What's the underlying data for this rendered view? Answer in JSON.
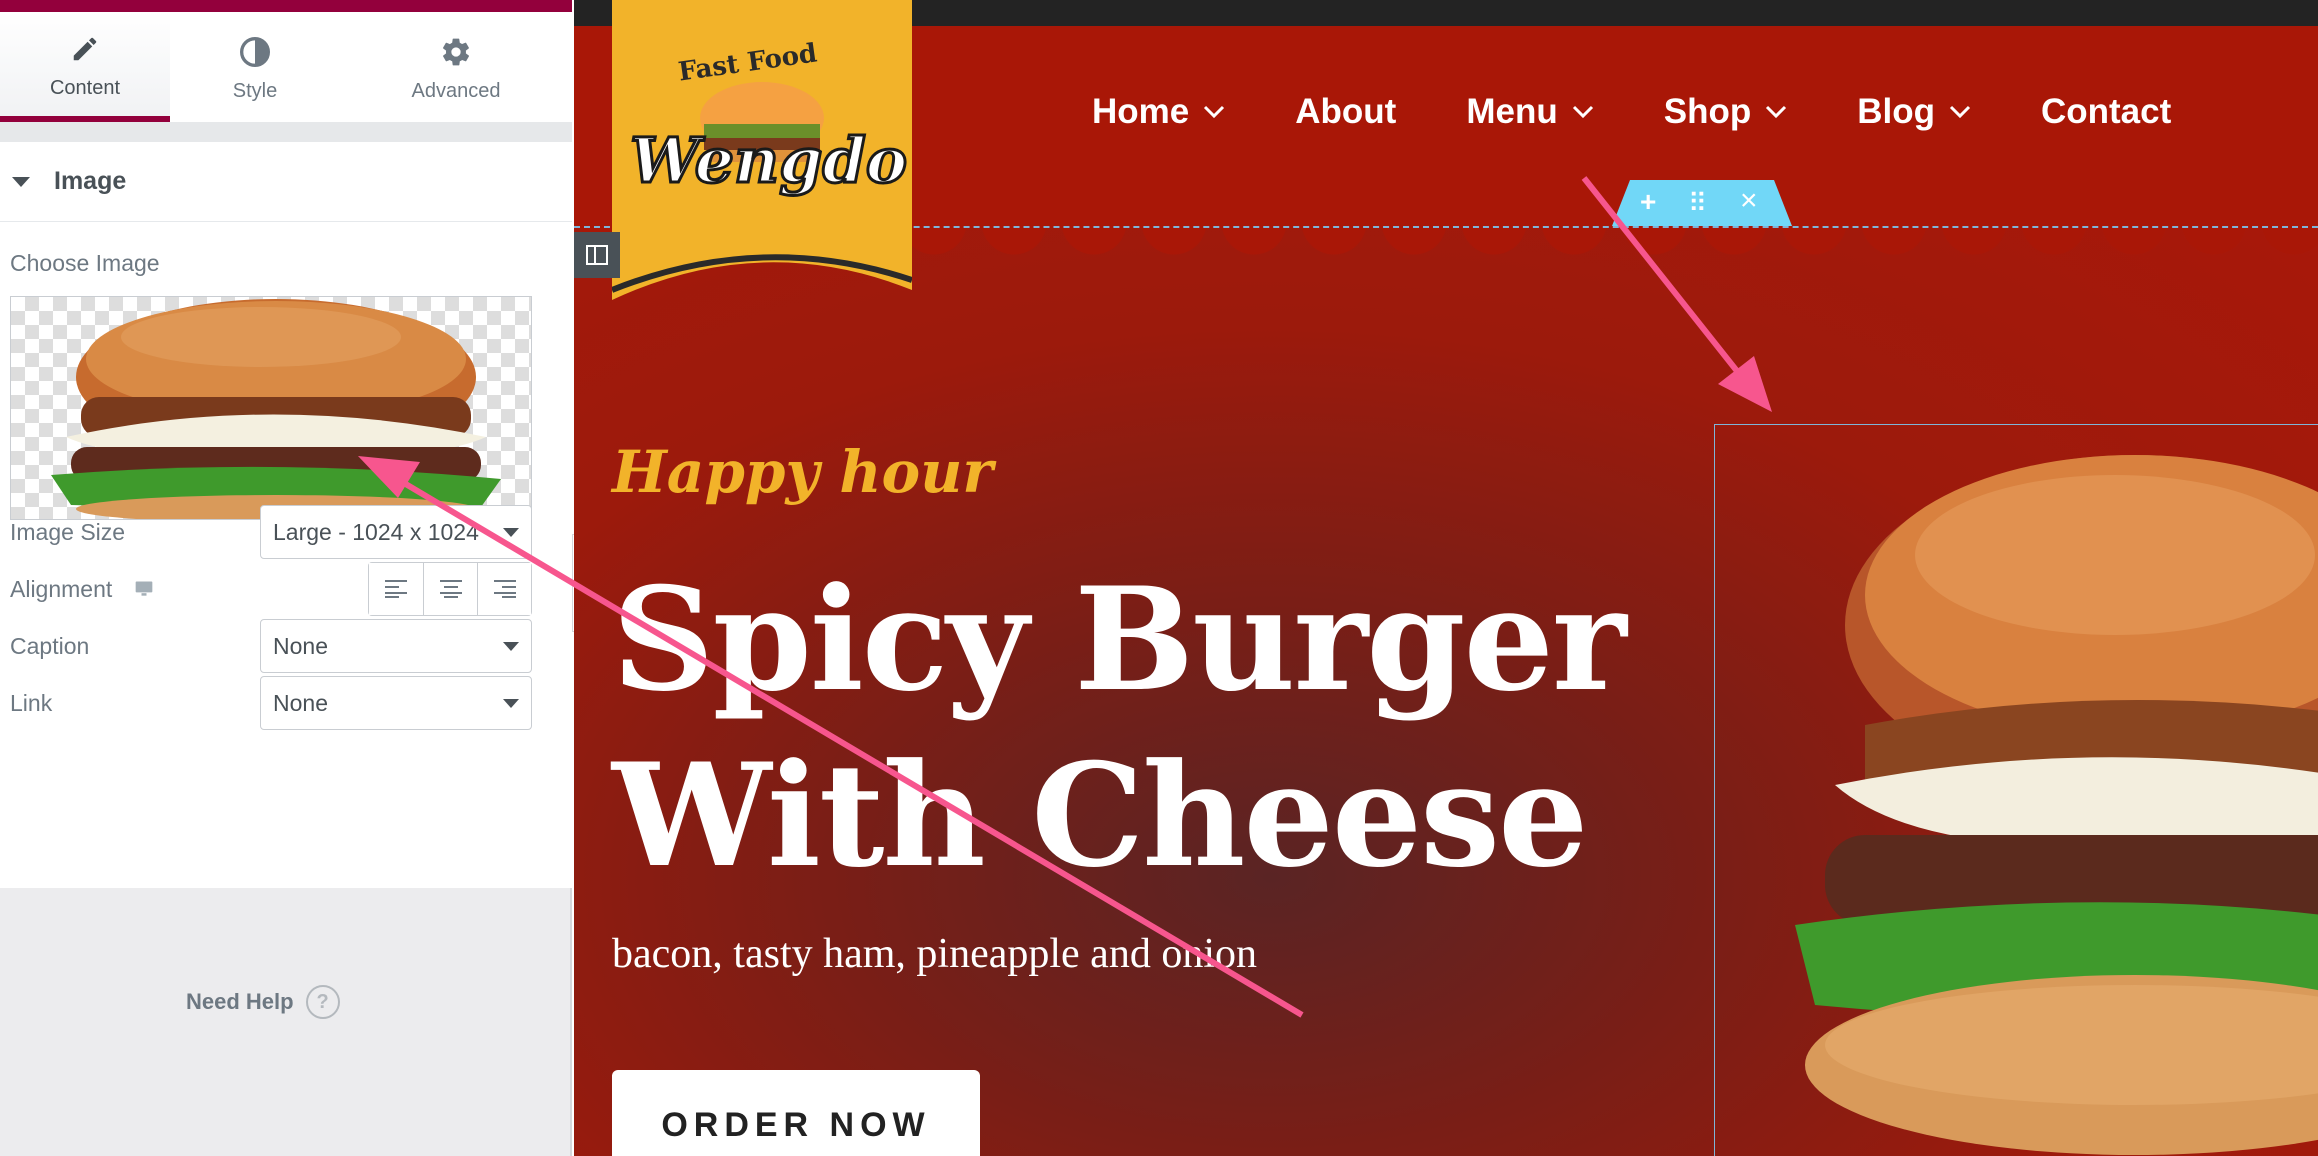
{
  "panel": {
    "tabs": [
      {
        "label": "Content",
        "icon": "pencil-icon",
        "active": true
      },
      {
        "label": "Style",
        "icon": "half-circle-icon",
        "active": false
      },
      {
        "label": "Advanced",
        "icon": "gear-icon",
        "active": false
      }
    ],
    "section_title": "Image",
    "choose_image_label": "Choose Image",
    "image_size": {
      "label": "Image Size",
      "value": "Large - 1024 x 1024"
    },
    "alignment": {
      "label": "Alignment",
      "device_icon": "desktop-icon",
      "options": [
        "align-left-icon",
        "align-center-icon",
        "align-right-icon"
      ]
    },
    "caption": {
      "label": "Caption",
      "value": "None"
    },
    "link": {
      "label": "Link",
      "value": "None"
    },
    "need_help": "Need Help",
    "help_icon": "?"
  },
  "preview": {
    "logo": {
      "top_text": "Fast Food",
      "brand": "Wengdo"
    },
    "nav": [
      {
        "label": "Home",
        "dropdown": true
      },
      {
        "label": "About",
        "dropdown": false
      },
      {
        "label": "Menu",
        "dropdown": true
      },
      {
        "label": "Shop",
        "dropdown": true
      },
      {
        "label": "Blog",
        "dropdown": true
      },
      {
        "label": "Contact",
        "dropdown": false
      }
    ],
    "section_handle": [
      "+",
      "⠿",
      "×"
    ],
    "hero": {
      "kicker": "Happy hour",
      "headline_line1": "Spicy Burger",
      "headline_line2": "With Cheese",
      "subtitle": "bacon, tasty ham, pineapple and onion",
      "cta": "ORDER NOW"
    }
  },
  "colors": {
    "brand_accent": "#93003c",
    "header_red": "#a91707",
    "gold": "#f2b32a",
    "annotation_arrow": "#f7568e",
    "handle_blue": "#71d7f7"
  }
}
